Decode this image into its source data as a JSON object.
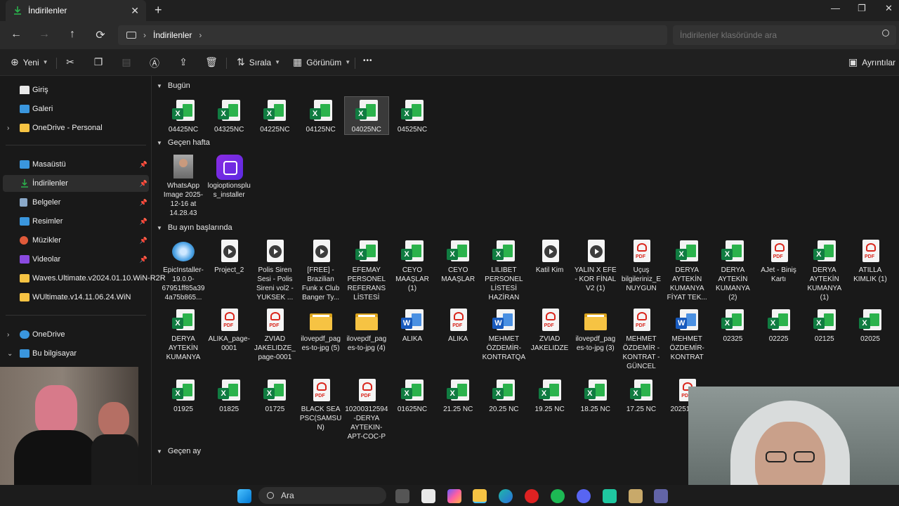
{
  "window": {
    "tab_title": "İndirilenler",
    "close": "✕",
    "new_tab": "+",
    "minimize": "—",
    "maximize": "❐",
    "close_window": "✕"
  },
  "navbar": {
    "back": "←",
    "forward": "→",
    "up": "↑",
    "refresh": "⟳",
    "breadcrumb": "İndirilenler",
    "search_placeholder": "İndirilenler klasöründe ara"
  },
  "commandbar": {
    "new": "Yeni",
    "sort": "Sırala",
    "view": "Görünüm",
    "more": "•••",
    "details": "Ayrıntılar"
  },
  "sidebar": {
    "items": [
      {
        "label": "Giriş",
        "icon": "home-icon",
        "color": "#e8e8e8"
      },
      {
        "label": "Galeri",
        "icon": "gallery-icon",
        "color": "#3a96dd"
      },
      {
        "label": "OneDrive - Personal",
        "icon": "folder-icon",
        "color": "#f6c343"
      },
      {
        "label": "Masaüstü",
        "icon": "desktop-icon",
        "color": "#3a96dd"
      },
      {
        "label": "İndirilenler",
        "icon": "download-icon",
        "color": "#2bb24c"
      },
      {
        "label": "Belgeler",
        "icon": "documents-icon",
        "color": "#8aa8c8"
      },
      {
        "label": "Resimler",
        "icon": "pictures-icon",
        "color": "#3a96dd"
      },
      {
        "label": "Müzikler",
        "icon": "music-icon",
        "color": "#e05a3a"
      },
      {
        "label": "Videolar",
        "icon": "videos-icon",
        "color": "#8a4ae0"
      },
      {
        "label": "Waves.Ultimate.v2024.01.10.WiN-R2R",
        "icon": "folder-icon",
        "color": "#f6c343"
      },
      {
        "label": "WUltimate.v14.11.06.24.WiN",
        "icon": "folder-icon",
        "color": "#f6c343"
      },
      {
        "label": "OneDrive",
        "icon": "cloud-icon",
        "color": "#3a96dd"
      },
      {
        "label": "Bu bilgisayar",
        "icon": "computer-icon",
        "color": "#3a96dd"
      }
    ]
  },
  "groups": {
    "today": "Bugün",
    "last_week": "Geçen hafta",
    "early_this_month": "Bu ayın başlarında",
    "last_month": "Geçen ay"
  },
  "files_today": [
    {
      "name": "04425NC",
      "type": "excel"
    },
    {
      "name": "04325NC",
      "type": "excel"
    },
    {
      "name": "04225NC",
      "type": "excel"
    },
    {
      "name": "04125NC",
      "type": "excel"
    },
    {
      "name": "04025NC",
      "type": "excel"
    },
    {
      "name": "04525NC",
      "type": "excel"
    }
  ],
  "files_last_week": [
    {
      "name": "WhatsApp Image 2025-12-16 at 14.28.43",
      "type": "photo"
    },
    {
      "name": "logioptionsplus_installer",
      "type": "logi"
    }
  ],
  "files_month_row1": [
    {
      "name": "EpicInstaller-19.0.0-67951ff85a394a75b865...",
      "type": "installer"
    },
    {
      "name": "Project_2",
      "type": "media"
    },
    {
      "name": "Polis Siren Sesi - Polis Sireni vol2 - YUKSEK ...",
      "type": "media"
    },
    {
      "name": "[FREE] - Brazilian Funk x Club Banger Ty...",
      "type": "media"
    },
    {
      "name": "EFEMAY PERSONEL REFERANS LİSTESİ",
      "type": "excel"
    },
    {
      "name": "CEYO MAAŞLAR (1)",
      "type": "excel"
    },
    {
      "name": "CEYO MAAŞLAR",
      "type": "excel"
    },
    {
      "name": "LILIBET PERSONEL LİSTESİ HAZİRAN",
      "type": "excel"
    },
    {
      "name": "Katil Kim",
      "type": "media"
    },
    {
      "name": "YALIN X EFE - KOR FİNAL V2 (1)",
      "type": "media"
    },
    {
      "name": "Uçuş bilgileriniz_ENUYGUN",
      "type": "pdf"
    },
    {
      "name": "DERYA AYTEKİN KUMANYA FİYAT TEK...",
      "type": "excel"
    },
    {
      "name": "DERYA AYTEKİN KUMANYA (2)",
      "type": "excel"
    },
    {
      "name": "AJet - Biniş Kartı",
      "type": "pdf"
    },
    {
      "name": "DERYA AYTEKİN KUMANYA (1)",
      "type": "excel"
    },
    {
      "name": "ATILLA KIMLIK (1)",
      "type": "pdf"
    }
  ],
  "files_month_row2": [
    {
      "name": "DERYA AYTEKİN KUMANYA",
      "type": "excel"
    },
    {
      "name": "ALIKA_page-0001",
      "type": "pdf"
    },
    {
      "name": "ZVIAD JAKELIDZE_page-0001",
      "type": "pdf"
    },
    {
      "name": "ilovepdf_pages-to-jpg (5)",
      "type": "folder"
    },
    {
      "name": "ilovepdf_pages-to-jpg (4)",
      "type": "folder"
    },
    {
      "name": "ALIKA",
      "type": "word"
    },
    {
      "name": "ALIKA",
      "type": "pdf"
    },
    {
      "name": "MEHMET ÖZDEMİR-KONTRATQA",
      "type": "word"
    },
    {
      "name": "ZVIAD JAKELIDZE",
      "type": "pdf"
    },
    {
      "name": "ilovepdf_pages-to-jpg (3)",
      "type": "folder"
    },
    {
      "name": "MEHMET ÖZDEMİR - KONTRAT - GÜNCEL",
      "type": "pdf"
    },
    {
      "name": "MEHMET ÖZDEMİR-KONTRAT",
      "type": "word"
    },
    {
      "name": "02325",
      "type": "excel"
    },
    {
      "name": "02225",
      "type": "excel"
    },
    {
      "name": "02125",
      "type": "excel"
    },
    {
      "name": "02025",
      "type": "excel"
    }
  ],
  "files_month_row3": [
    {
      "name": "01925",
      "type": "excel"
    },
    {
      "name": "01825",
      "type": "excel"
    },
    {
      "name": "01725",
      "type": "excel"
    },
    {
      "name": "BLACK SEA PSC(SAMSUN)",
      "type": "pdf"
    },
    {
      "name": "10200312594-DERYA AYTEKIN-APT-COC-P",
      "type": "pdf"
    },
    {
      "name": "01625NC",
      "type": "excel"
    },
    {
      "name": "21.25 NC",
      "type": "excel"
    },
    {
      "name": "20.25 NC",
      "type": "excel"
    },
    {
      "name": "19.25 NC",
      "type": "excel"
    },
    {
      "name": "18.25 NC",
      "type": "excel"
    },
    {
      "name": "17.25 NC",
      "type": "excel"
    },
    {
      "name": "20251 729",
      "type": "pdf"
    }
  ],
  "taskbar": {
    "search_label": "Ara"
  }
}
